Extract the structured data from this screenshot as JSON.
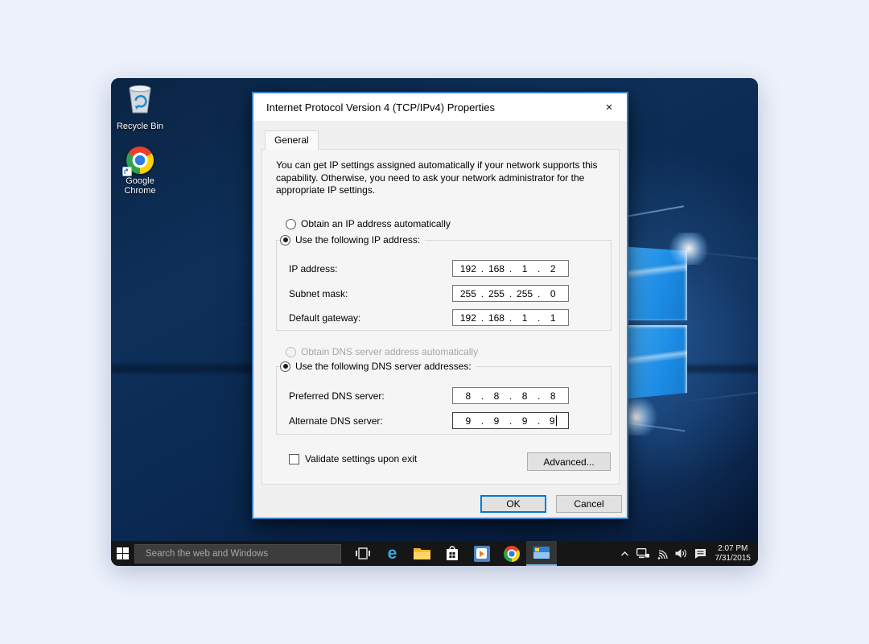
{
  "window": {
    "title": "Internet Protocol Version 4 (TCP/IPv4) Properties",
    "close_glyph": "×"
  },
  "tabs": {
    "general": "General"
  },
  "general_tab": {
    "description": "You can get IP settings assigned automatically if your network supports this capability. Otherwise, you need to ask your network administrator for the appropriate IP settings.",
    "obtain_ip_radio": "Obtain an IP address automatically",
    "ip_group": {
      "legend": "Use the following IP address:",
      "fields": [
        {
          "label": "IP address:",
          "octets": [
            "192",
            "168",
            "1",
            "2"
          ]
        },
        {
          "label": "Subnet mask:",
          "octets": [
            "255",
            "255",
            "255",
            "0"
          ]
        },
        {
          "label": "Default gateway:",
          "octets": [
            "192",
            "168",
            "1",
            "1"
          ]
        }
      ]
    },
    "obtain_dns_radio": "Obtain DNS server address automatically",
    "dns_group": {
      "legend": "Use the following DNS server addresses:",
      "fields": [
        {
          "label": "Preferred DNS server:",
          "octets": [
            "8",
            "8",
            "8",
            "8"
          ]
        },
        {
          "label": "Alternate DNS server:",
          "octets": [
            "9",
            "9",
            "9",
            "9"
          ]
        }
      ]
    },
    "validate_label": "Validate settings upon exit",
    "advanced_button": "Advanced..."
  },
  "dialog_buttons": {
    "ok": "OK",
    "cancel": "Cancel"
  },
  "desktop": {
    "icons": [
      {
        "label": "Recycle Bin"
      },
      {
        "label": "Google Chrome"
      }
    ]
  },
  "taskbar": {
    "search_placeholder": "Search the web and Windows",
    "clock_time": "2:07 PM",
    "clock_date": "7/31/2015"
  },
  "icons": {
    "edge_glyph": "e"
  },
  "colors": {
    "accent": "#0078d7",
    "window_border": "#3b7dc4",
    "taskbar_bg": "#161616"
  }
}
